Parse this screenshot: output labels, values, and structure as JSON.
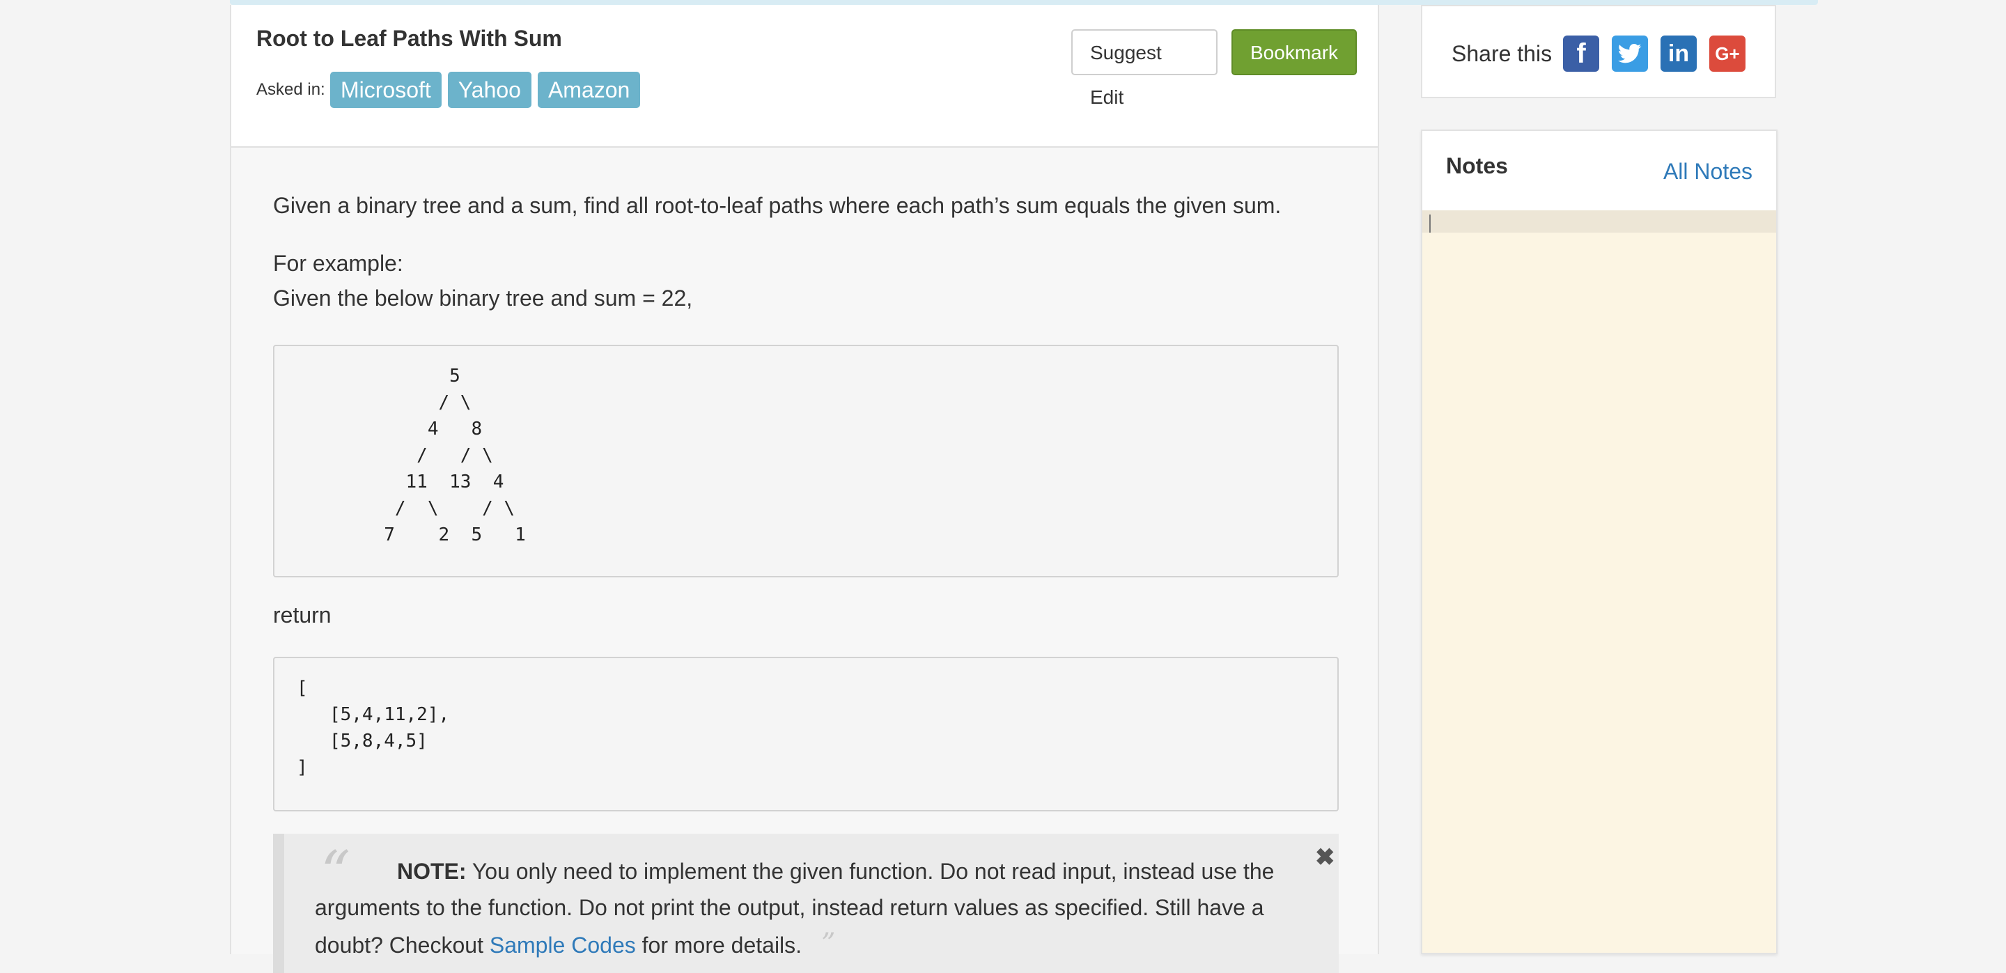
{
  "problem": {
    "title": "Root to Leaf Paths With Sum",
    "asked_in_label": "Asked in:",
    "companies": [
      "Microsoft",
      "Yahoo",
      "Amazon"
    ],
    "suggest_edit_label": "Suggest Edit",
    "bookmark_label": "Bookmark"
  },
  "content": {
    "description": "Given a binary tree and a sum, find all root-to-leaf paths where each path’s sum equals the given sum.",
    "example_label": "For example:",
    "example_intro": "Given the below binary tree and sum = 22,",
    "tree_code": "              5\n             / \\\n            4   8\n           /   / \\\n          11  13  4\n         /  \\    / \\\n        7    2  5   1",
    "return_label": "return",
    "return_code": "[\n   [5,4,11,2],\n   [5,8,4,5]\n]"
  },
  "note": {
    "bold_label": "NOTE:",
    "text_before_link": " You only need to implement the given function. Do not read input, instead use the arguments to the function. Do not print the output, instead return values as specified. Still have a doubt? Checkout ",
    "link_text": "Sample Codes",
    "text_after_link": " for more details.",
    "quote_open": "“",
    "quote_close": "”",
    "close_symbol": "✖"
  },
  "sidebar": {
    "share_label": "Share this",
    "social": [
      {
        "name": "facebook",
        "glyph": "f",
        "color": "#3b5fa6"
      },
      {
        "name": "twitter",
        "color": "#3a9de4"
      },
      {
        "name": "linkedin",
        "glyph": "in",
        "color": "#2a71b5"
      },
      {
        "name": "google-plus",
        "glyph": "G+",
        "color": "#dc4b3c"
      }
    ],
    "notes_title": "Notes",
    "all_notes_label": "All Notes",
    "notes_value": ""
  },
  "colors": {
    "tag_bg": "#6cb3cb",
    "bookmark_bg": "#70a031",
    "link": "#2f7ab9",
    "notes_bg": "#fcf5e3"
  }
}
